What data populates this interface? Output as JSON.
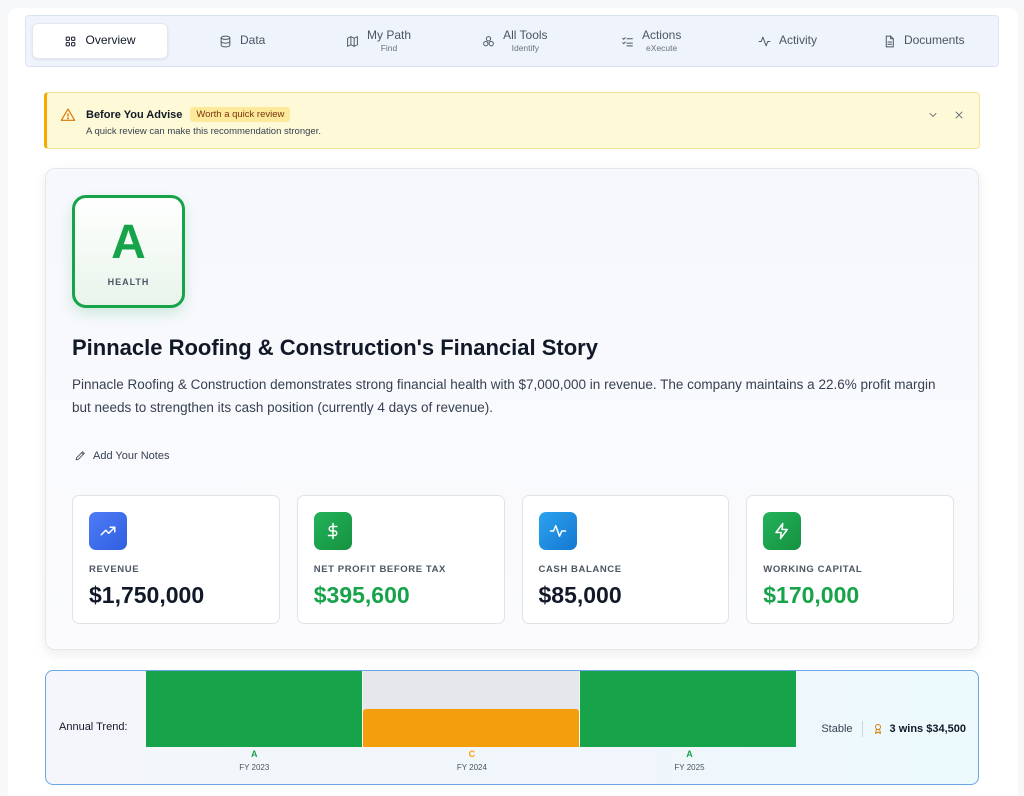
{
  "tabs": [
    {
      "label": "Overview",
      "sub": "",
      "icon": "grid-icon",
      "active": true
    },
    {
      "label": "Data",
      "sub": "",
      "icon": "database-icon"
    },
    {
      "label": "My Path",
      "sub": "Find",
      "icon": "map-icon"
    },
    {
      "label": "All Tools",
      "sub": "Identify",
      "icon": "tools-icon"
    },
    {
      "label": "Actions",
      "sub": "eXecute",
      "icon": "checklist-icon"
    },
    {
      "label": "Activity",
      "sub": "",
      "icon": "activity-icon"
    },
    {
      "label": "Documents",
      "sub": "",
      "icon": "document-icon"
    }
  ],
  "alert": {
    "title": "Before You Advise",
    "badge": "Worth a quick review",
    "description": "A quick review can make this recommendation stronger.",
    "accent_color": "#f2a900"
  },
  "health": {
    "grade": "A",
    "label": "HEALTH",
    "color": "#16a34a"
  },
  "story": {
    "title": "Pinnacle Roofing & Construction's Financial Story",
    "text": "Pinnacle Roofing & Construction demonstrates strong financial health with $7,000,000 in revenue. The company maintains a 22.6% profit margin but needs to strengthen its cash position (currently 4 days of revenue).",
    "notes_label": "Add Your Notes"
  },
  "metrics": [
    {
      "label": "REVENUE",
      "value": "$1,750,000",
      "icon": "trending-up-icon",
      "icon_bg": "#3b6cf0",
      "value_color": "#111827"
    },
    {
      "label": "NET PROFIT BEFORE TAX",
      "value": "$395,600",
      "icon": "dollar-icon",
      "icon_bg": "#16a34a",
      "value_color": "#16a34a"
    },
    {
      "label": "CASH BALANCE",
      "value": "$85,000",
      "icon": "pulse-icon",
      "icon_bg": "#1e8fe0",
      "value_color": "#111827"
    },
    {
      "label": "WORKING CAPITAL",
      "value": "$170,000",
      "icon": "bolt-icon",
      "icon_bg": "#16a34a",
      "value_color": "#16a34a"
    }
  ],
  "trend": {
    "label": "Annual Trend:",
    "years": [
      {
        "year": "FY 2023",
        "grade": "A",
        "color": "#16a34a",
        "level": 1.0
      },
      {
        "year": "FY 2024",
        "grade": "C",
        "color": "#f59e0b",
        "level": 0.5
      },
      {
        "year": "FY 2025",
        "grade": "A",
        "color": "#16a34a",
        "level": 1.0
      }
    ],
    "status": "Stable",
    "wins": "3 wins $34,500"
  }
}
